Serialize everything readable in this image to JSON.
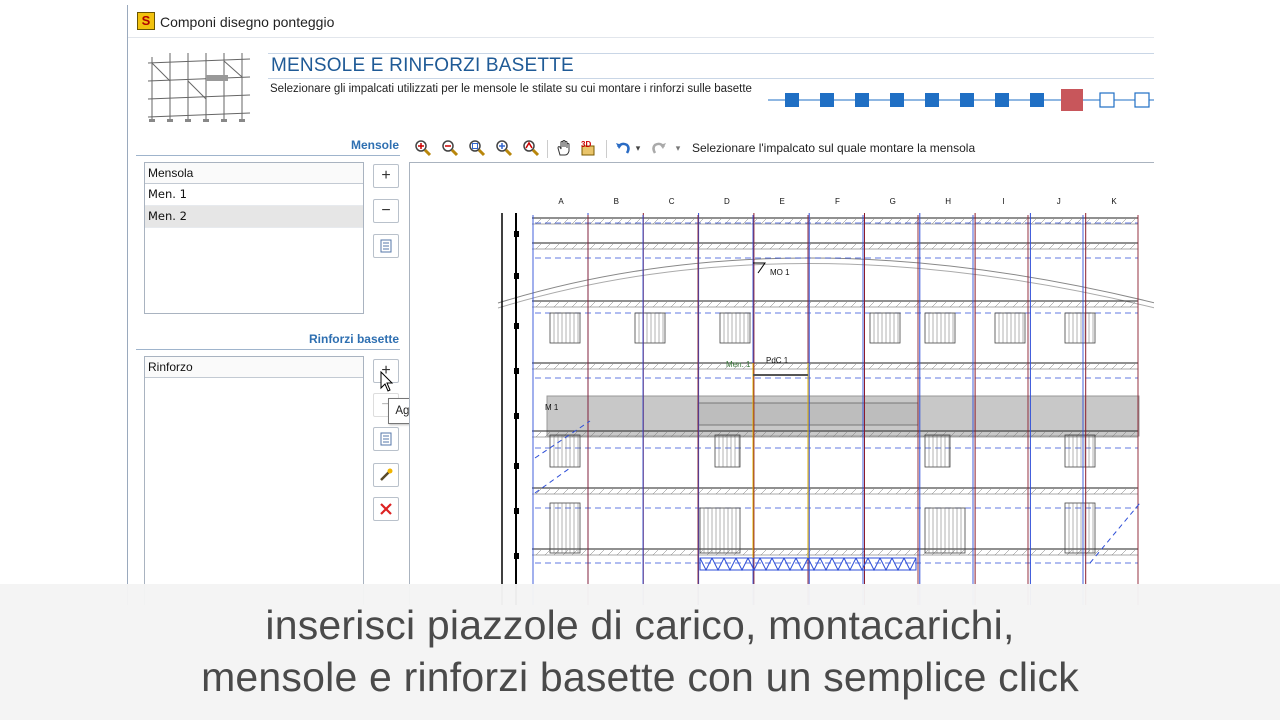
{
  "window": {
    "title": "Componi disegno ponteggio"
  },
  "step": {
    "title": "MENSOLE E RINFORZI BASETTE",
    "description": "Selezionare gli impalcati utilizzati per le mensole le stilate su cui montare i rinforzi sulle basette",
    "total_steps": 11,
    "current_step": 9
  },
  "mensole": {
    "label": "Mensole",
    "header": "Mensola",
    "items": [
      "Men. 1",
      "Men. 2"
    ],
    "selected_index": 1
  },
  "rinforzi": {
    "label": "Rinforzi basette",
    "header": "Rinforzo"
  },
  "tooltip": {
    "text": "Aggiungi un rinforzo"
  },
  "toolbar": {
    "instruction": "Selezionare l'impalcato sul quale montare la mensola"
  },
  "drawing": {
    "columns": [
      "A",
      "B",
      "C",
      "D",
      "E",
      "F",
      "G",
      "H",
      "I",
      "J",
      "K"
    ],
    "labels": {
      "mo": "MO 1",
      "men": "Men. 1",
      "pdc": "PdC 1",
      "m": "M 1"
    }
  },
  "caption": {
    "line1": "inserisci piazzole di carico, montacarichi,",
    "line2": "mensole e rinforzi basette con un semplice click"
  },
  "colors": {
    "accent": "#1f5a96",
    "step_done": "#1f6fc4",
    "step_current": "#c8565b",
    "grid_blue": "#2f4fd8",
    "grid_red": "#8b1c2c"
  }
}
